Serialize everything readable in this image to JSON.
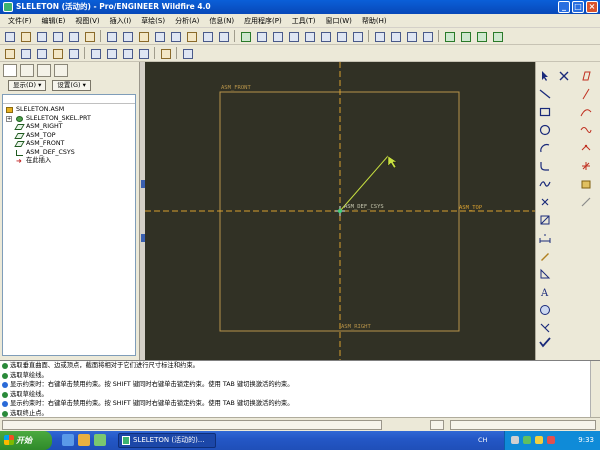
{
  "window": {
    "title": "SLELETON (活动的) - Pro/ENGINEER Wildfire 4.0",
    "controls": [
      "_",
      "□",
      "×"
    ]
  },
  "menubar": {
    "items": [
      "文件(F)",
      "编辑(E)",
      "视图(V)",
      "插入(I)",
      "草绘(S)",
      "分析(A)",
      "信息(N)",
      "应用程序(P)",
      "工具(T)",
      "窗口(W)",
      "帮助(H)"
    ]
  },
  "navigator": {
    "display_button": "显示(D) ▾",
    "settings_button": "设置(G) ▾",
    "tree": [
      {
        "label": "SLELETON.ASM",
        "icon": "assembly-icon"
      },
      {
        "label": "SLELETON_SKEL.PRT",
        "icon": "part-icon"
      },
      {
        "label": "ASM_RIGHT",
        "icon": "datum-plane-icon"
      },
      {
        "label": "ASM_TOP",
        "icon": "datum-plane-icon"
      },
      {
        "label": "ASM_FRONT",
        "icon": "datum-plane-icon"
      },
      {
        "label": "ASM_DEF_CSYS",
        "icon": "csys-icon"
      },
      {
        "label": "在此插入",
        "icon": "insert-here-icon"
      }
    ]
  },
  "graphics": {
    "plane_labels": {
      "front": "ASM_FRONT",
      "top": "ASM_TOP",
      "right": "ASM_RIGHT",
      "csys": "ASM_DEF_CSYS"
    },
    "colors": {
      "background": "#313125",
      "plane": "#b8944a",
      "csys": "#c8e040"
    }
  },
  "messages": [
    {
      "type": "prompt",
      "text": "选取垂直曲面、边或顶点，截面将相对于它们进行尺寸标注和约束。"
    },
    {
      "type": "prompt",
      "text": "选取草绘线。"
    },
    {
      "type": "info",
      "text": "显示约束时：右键单击禁用约束。按 SHIFT 键同时右键单击锁定约束。使用 TAB 键切换激活的约束。"
    },
    {
      "type": "prompt",
      "text": "选取草绘线。"
    },
    {
      "type": "info",
      "text": "显示约束时：右键单击禁用约束。按 SHIFT 键同时右键单击锁定约束。使用 TAB 键切换激活的约束。"
    },
    {
      "type": "prompt",
      "text": "选取终止点。"
    },
    {
      "type": "info",
      "text": "显示约束时：右键单击禁用约束。按 SHIFT 键同时右键单击锁定约束。使用 TAB 键切换激活的约束。"
    }
  ],
  "taskbar": {
    "start_label": "开始",
    "task_button": "SLELETON (活动的)...",
    "language": "CH",
    "clock": "9:33"
  }
}
